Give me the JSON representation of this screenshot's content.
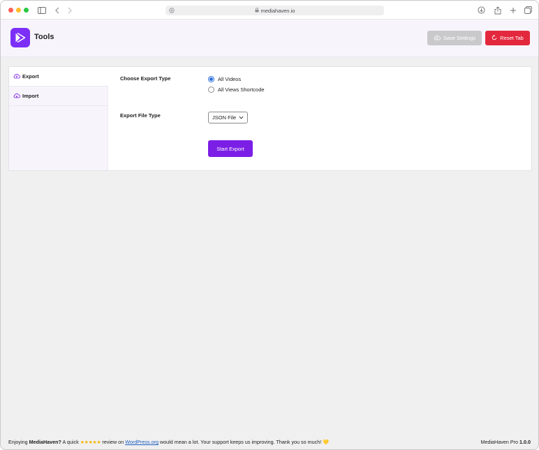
{
  "browser": {
    "url": "mediahaven.io"
  },
  "header": {
    "title": "Tools",
    "save_label": "Save Settings",
    "reset_label": "Reset Tab"
  },
  "sidebar": {
    "items": [
      {
        "label": "Export",
        "icon": "cloud-upload-icon",
        "active": true
      },
      {
        "label": "Import",
        "icon": "cloud-download-icon",
        "active": false
      }
    ]
  },
  "export_form": {
    "type_label": "Choose Export Type",
    "options": [
      {
        "label": "All Videos",
        "checked": true
      },
      {
        "label": "All Views Shortcode",
        "checked": false
      }
    ],
    "file_type_label": "Export File Type",
    "file_type_value": "JSON File",
    "start_label": "Start Export"
  },
  "footer": {
    "prefix": "Enjoying ",
    "brand": "MediaHaven?",
    "mid": " A quick ",
    "stars": "★★★★★",
    "review_on": " review on ",
    "link": "WordPress.org",
    "suffix": " would mean a lot. Your support keeps us improving. Thank you so much! ",
    "heart": "💛",
    "version_prefix": "MediaHaven Pro ",
    "version": "1.0.0"
  },
  "colors": {
    "accent": "#7b1fe6",
    "danger": "#e3283d",
    "disabled": "#c9c9cc"
  }
}
